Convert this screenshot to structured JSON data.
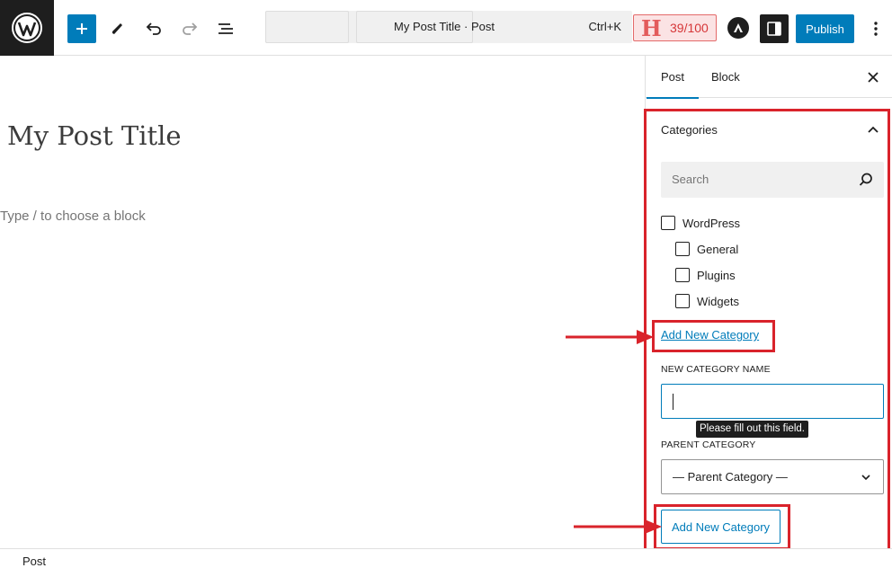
{
  "header": {
    "command_palette_title": "My Post Title · Post",
    "command_shortcut": "Ctrl+K",
    "seo_score": "39/100",
    "seo_letter": "H",
    "publish_label": "Publish"
  },
  "editor": {
    "post_title": "My Post Title",
    "block_placeholder": "Type / to choose a block"
  },
  "sidebar": {
    "tabs": [
      {
        "label": "Post",
        "active": true
      },
      {
        "label": "Block",
        "active": false
      }
    ],
    "categories_panel": {
      "title": "Categories",
      "search_placeholder": "Search",
      "categories": [
        {
          "label": "WordPress",
          "checked": false,
          "level": 0
        },
        {
          "label": "General",
          "checked": false,
          "level": 1
        },
        {
          "label": "Plugins",
          "checked": false,
          "level": 1
        },
        {
          "label": "Widgets",
          "checked": false,
          "level": 1
        }
      ],
      "add_new_link": "Add New Category",
      "new_category_label": "NEW CATEGORY NAME",
      "validation_tooltip": "Please fill out this field.",
      "parent_category_label": "PARENT CATEGORY",
      "parent_category_value": "— Parent Category —",
      "add_new_button": "Add New Category"
    }
  },
  "footer": {
    "breadcrumb": "Post"
  },
  "colors": {
    "accent": "#007cba",
    "annotation_red": "#d9232b",
    "dark": "#1e1e1e"
  }
}
